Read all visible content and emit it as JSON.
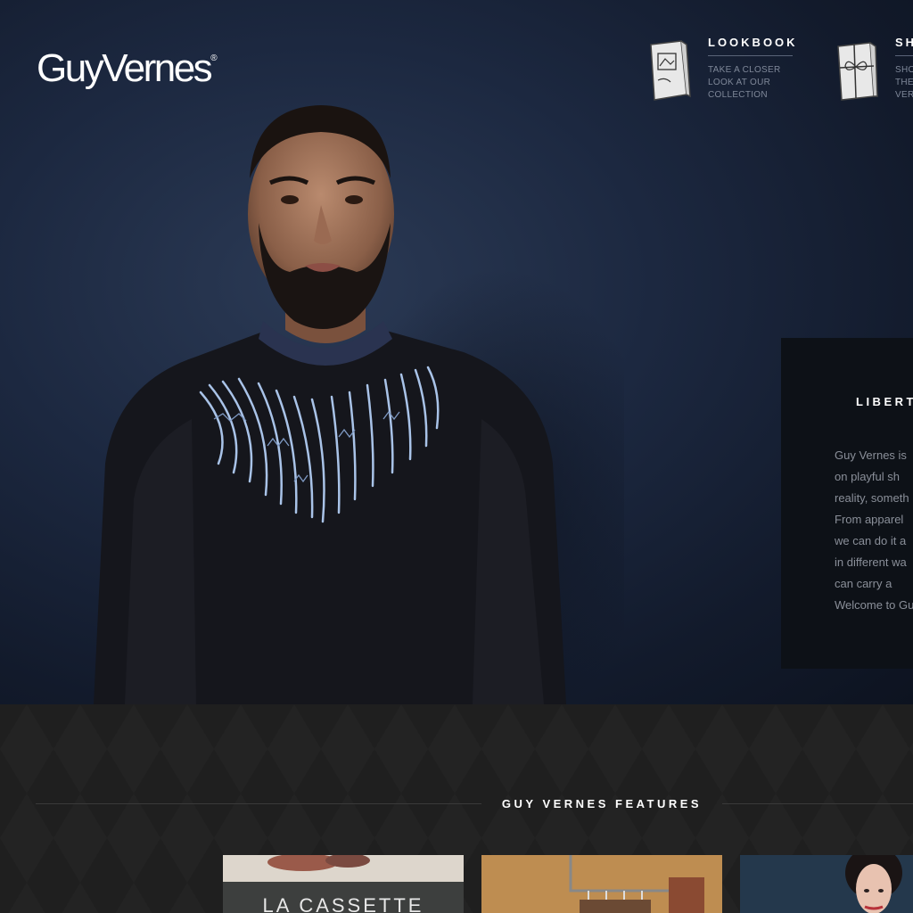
{
  "brand": {
    "name": "GuyVernes",
    "mark": "®"
  },
  "nav": [
    {
      "title": "LOOKBOOK",
      "lines": [
        "TAKE A CLOSER",
        "LOOK AT OUR",
        "COLLECTION"
      ],
      "icon": "book-icon"
    },
    {
      "title": "SH",
      "lines": [
        "SHO",
        "THE",
        "VER"
      ],
      "icon": "gift-icon"
    }
  ],
  "about": {
    "title": "LIBERT",
    "lines": [
      "Guy Vernes is",
      "on playful sh",
      "reality, someth",
      "From apparel",
      "we can do it a",
      "in different wa",
      "can carry a",
      "Welcome to Gu"
    ]
  },
  "features": {
    "title": "GUY VERNES FEATURES"
  },
  "cards": [
    {
      "icon": "sign-image",
      "text": "LA CASSETTE"
    },
    {
      "icon": "clothes-rack-image"
    },
    {
      "icon": "woman-portrait-image"
    }
  ]
}
